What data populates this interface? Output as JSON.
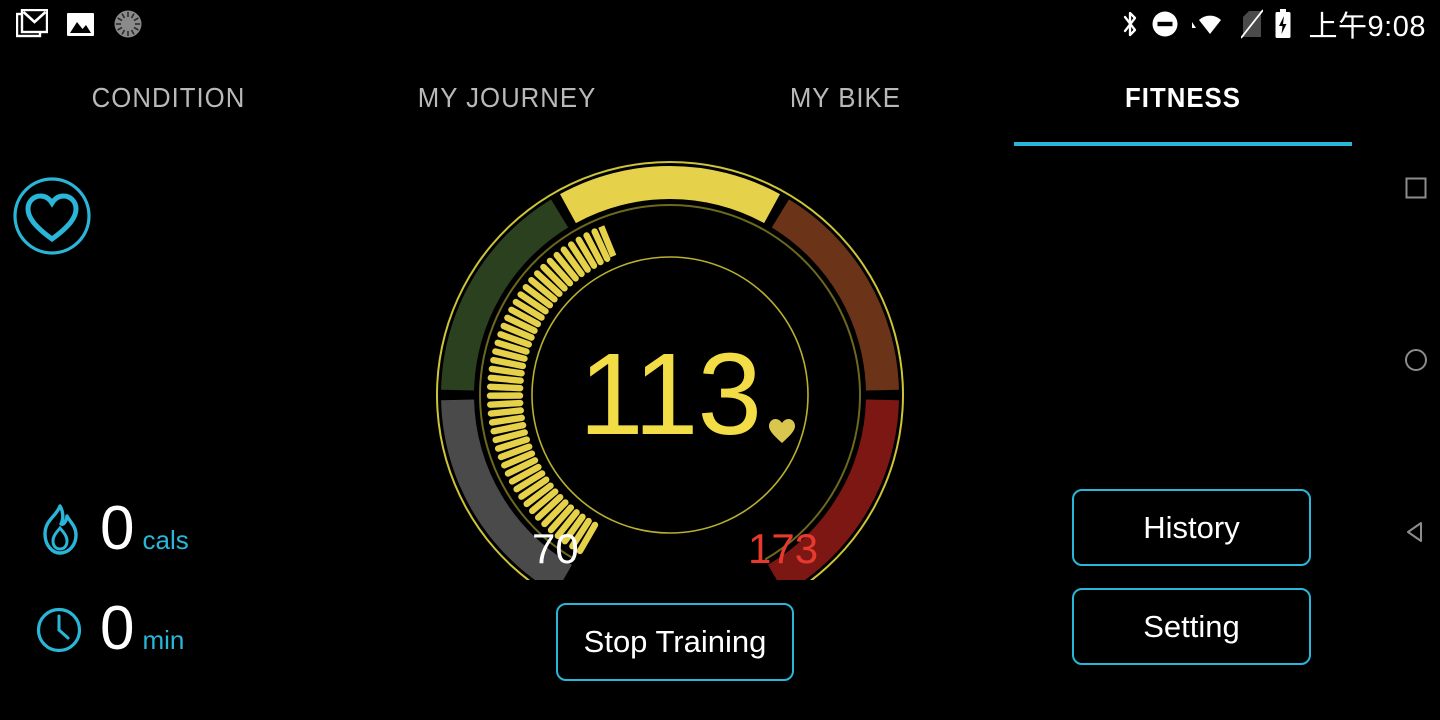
{
  "statusbar": {
    "left_icons": [
      "gmail-icon",
      "photo-icon",
      "loading-spinner-icon"
    ],
    "right_icons": [
      "bluetooth-icon",
      "do-not-disturb-icon",
      "wifi-icon",
      "no-sim-icon",
      "battery-charging-icon"
    ],
    "time": "上午9:08"
  },
  "tabs": [
    {
      "label": "CONDITION",
      "active": false
    },
    {
      "label": "MY JOURNEY",
      "active": false
    },
    {
      "label": "MY BIKE",
      "active": false
    },
    {
      "label": "FITNESS",
      "active": true
    }
  ],
  "sidebar": {
    "heart_icon": "heart-in-circle-icon",
    "stats": [
      {
        "icon": "flame-icon",
        "value": "0",
        "unit": "cals"
      },
      {
        "icon": "clock-icon",
        "value": "0",
        "unit": "min"
      }
    ]
  },
  "gauge": {
    "current_value": "113",
    "min_label": "70",
    "max_label": "173",
    "heart_marker": "heart-icon",
    "zones": [
      {
        "name": "rest",
        "color": "#4a4a4a"
      },
      {
        "name": "warmup",
        "color": "#2a401f"
      },
      {
        "name": "fatburn",
        "color": "#e6d24a"
      },
      {
        "name": "cardio",
        "color": "#6b3318"
      },
      {
        "name": "peak",
        "color": "#7d1714"
      }
    ],
    "ring_outline_color": "#d8cf3a",
    "tick_color": "#e6d24a"
  },
  "buttons": {
    "stop_training": "Stop Training",
    "history": "History",
    "setting": "Setting"
  },
  "navbar": {
    "recents": "recents-square-icon",
    "home": "home-circle-icon",
    "back": "back-triangle-icon"
  },
  "colors": {
    "accent_cyan": "#29b6d8",
    "value_yellow": "#f2dd46",
    "max_red": "#e8392f",
    "background": "#000000"
  }
}
